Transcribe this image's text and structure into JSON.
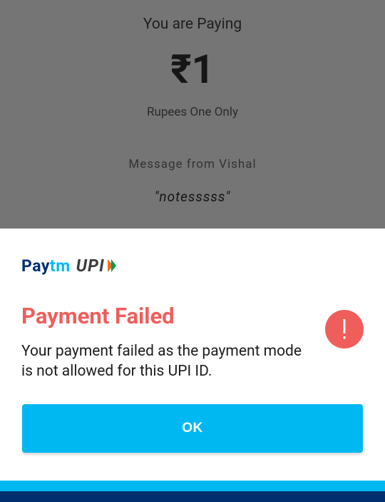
{
  "background_screen": {
    "paying_label": "You are Paying",
    "amount": "₹1",
    "amount_words": "Rupees One Only",
    "message_label": "Message from Vishal",
    "message_text": "\"notesssss\""
  },
  "dialog": {
    "logo": {
      "paytm_pay": "Pay",
      "paytm_tm": "tm",
      "upi": "UPI"
    },
    "title": "Payment Failed",
    "body": "Your payment failed as the payment mode is not allowed for this UPI ID.",
    "ok_label": "OK",
    "icon": "exclamation-icon"
  },
  "colors": {
    "error_red": "#ef5e5b",
    "paytm_blue": "#00b8f1",
    "paytm_navy": "#002e6e",
    "dim_overlay": "#757575"
  }
}
